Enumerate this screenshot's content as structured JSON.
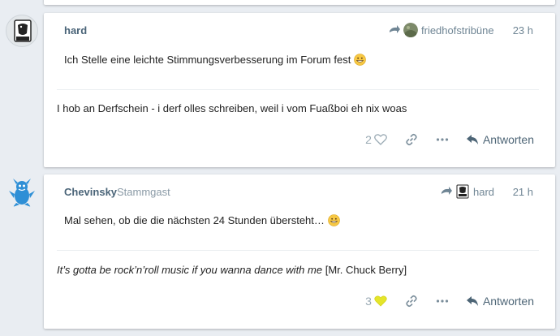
{
  "colors": {
    "background": "#e9edf2",
    "card": "#ffffff",
    "author": "#4a6478",
    "muted": "#6f8594",
    "liked_heart": "#e5e52a"
  },
  "posts": [
    {
      "author": "hard",
      "author_title": "",
      "reply_to": "friedhofstribüne",
      "time": "23 h",
      "text": "Ich Stelle eine leichte Stimmungsverbesserung im Forum fest",
      "emoji": "grinning-face",
      "signature": "I hob an Derfschein - i derf olles schreiben, weil i vom Fuaßboi eh nix woas",
      "signature_italic": "",
      "signature_rest": "",
      "likes": "2",
      "liked": false,
      "reply_label": "Antworten"
    },
    {
      "author": "Chevinsky",
      "author_title": "Stammgast",
      "reply_to": "hard",
      "time": "21 h",
      "text": "Mal sehen, ob die die nächsten 24 Stunden übersteht…",
      "emoji": "grinning-face",
      "signature": "",
      "signature_italic": "It’s gotta be rock’n’roll music if you wanna dance with me",
      "signature_rest": " [Mr. Chuck Berry]",
      "likes": "3",
      "liked": true,
      "reply_label": "Antworten"
    }
  ]
}
